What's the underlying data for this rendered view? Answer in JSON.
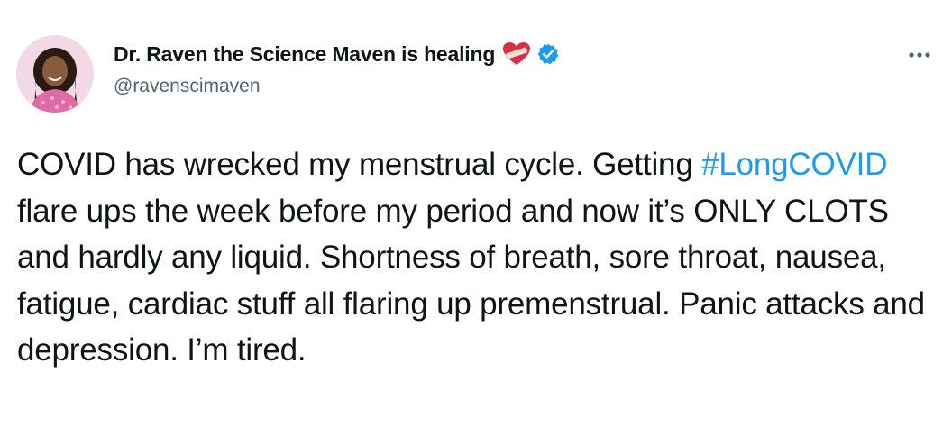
{
  "tweet": {
    "author": {
      "display_name": "Dr. Raven the Science Maven is healing",
      "handle": "@ravenscimaven",
      "verified": true,
      "name_emoji": "mending-heart-icon"
    },
    "text": {
      "part1": "COVID has wrecked my menstrual cycle. Getting ",
      "hashtag": "#LongCOVID",
      "part2": " flare ups the week before my period and now it’s ONLY CLOTS and hardly any liquid. Shortness of breath, sore throat, nausea, fatigue, cardiac stuff all flaring up premenstrual. Panic attacks and depression. I’m tired."
    },
    "more_icon": "more-horizontal-icon"
  },
  "colors": {
    "link": "#1d9bf0",
    "verified": "#1d9bf0",
    "text": "#0f1419",
    "secondary": "#536471"
  }
}
